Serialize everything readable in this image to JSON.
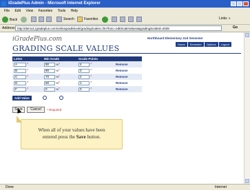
{
  "window": {
    "title": "iGradePlus Admin - Microsoft Internet Explorer"
  },
  "menu": [
    "File",
    "Edit",
    "View",
    "Favorites",
    "Tools",
    "Help"
  ],
  "toolbar": {
    "back_label": "Back",
    "search_label": "Search",
    "favorites_label": "Favorites",
    "links_label": "Links"
  },
  "address": {
    "label": "Address",
    "url": "http://demo1.igradeplus.com/onlinegradebook/gradingScales.cfm?func=editScaleValues&gradingScaleId=4039",
    "go_label": "Go"
  },
  "site": {
    "brand": "iGradePlus.com",
    "school": "Northboard Elementary  2nd Semester",
    "nav": [
      "Home",
      "Semester",
      "Options",
      "Logout"
    ],
    "page_heading": "GRADING SCALE VALUES"
  },
  "grading_table": {
    "headers": [
      "Letter",
      "Min Grade",
      "Grade Points",
      ""
    ],
    "rows": [
      {
        "letter": "A",
        "min": "90",
        "points": "4",
        "action": "Remove"
      },
      {
        "letter": "B",
        "min": "80",
        "points": "3",
        "action": "Remove"
      },
      {
        "letter": "C",
        "min": "70",
        "points": "2",
        "action": "Remove"
      },
      {
        "letter": "D",
        "min": "60",
        "points": "1",
        "action": "Remove"
      },
      {
        "letter": "F",
        "min": "0",
        "points": "0",
        "action": "Remove"
      }
    ],
    "pct_symbol": "%",
    "required_star": "*"
  },
  "buttons": {
    "add_value": "Add Value",
    "save": "Save",
    "cancel": "Cancel",
    "required_note": "* Required"
  },
  "tooltip": {
    "line1": "When all of your values have been",
    "line2_prefix": "entered press the ",
    "line2_bold": "Save",
    "line2_suffix": " button."
  },
  "status": {
    "left": "Done",
    "right": "Internet"
  }
}
